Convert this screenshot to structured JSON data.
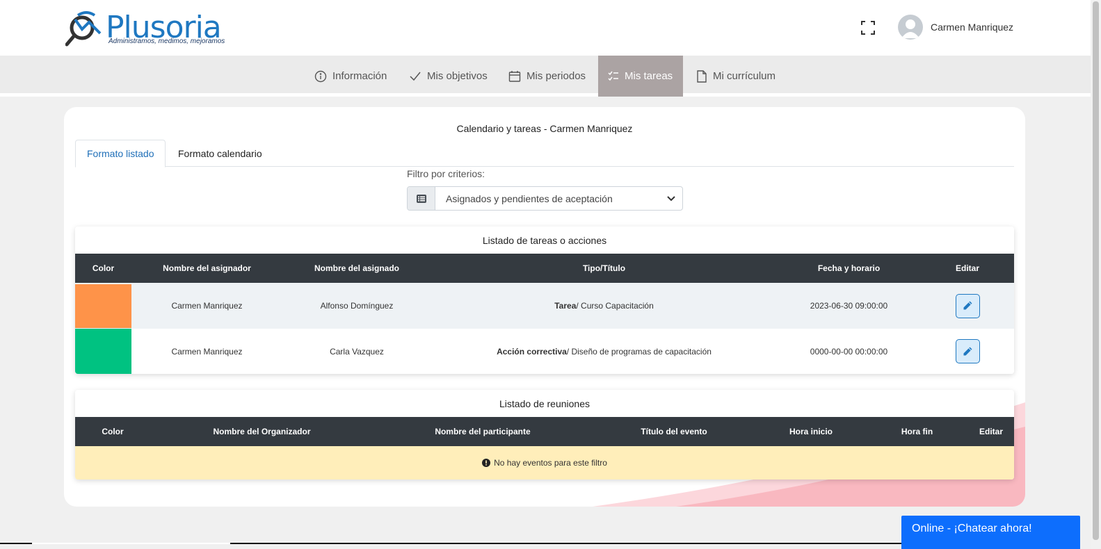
{
  "header": {
    "logo_text": "Plusoria",
    "logo_tagline": "Administramos, medimos, mejoramos",
    "user_name": "Carmen Manriquez"
  },
  "nav": [
    {
      "label": "Información",
      "icon": "info-icon"
    },
    {
      "label": "Mis objetivos",
      "icon": "check-icon"
    },
    {
      "label": "Mis periodos",
      "icon": "calendar-icon"
    },
    {
      "label": "Mis tareas",
      "icon": "tasks-icon",
      "active": true
    },
    {
      "label": "Mi currículum",
      "icon": "document-icon"
    }
  ],
  "page": {
    "title": "Calendario y tareas - Carmen Manriquez",
    "tabs": [
      "Formato listado",
      "Formato calendario"
    ],
    "filter_label": "Filtro por criterios:",
    "filter_value": "Asignados y pendientes de aceptación"
  },
  "tasks": {
    "title": "Listado de tareas o acciones",
    "columns": [
      "Color",
      "Nombre del asignador",
      "Nombre del asignado",
      "Tipo/Título",
      "Fecha y horario",
      "Editar"
    ],
    "rows": [
      {
        "color": "#fe9349",
        "assigner": "Carmen Manriquez",
        "assignee": "Alfonso Domínguez",
        "type": "Tarea",
        "title": "/ Curso Capacitación",
        "datetime": "2023-06-30 09:00:00"
      },
      {
        "color": "#00c281",
        "assigner": "Carmen Manriquez",
        "assignee": "Carla Vazquez",
        "type": "Acción correctiva",
        "title": "/ Diseño de programas de capacitación",
        "datetime": "0000-00-00 00:00:00"
      }
    ]
  },
  "meetings": {
    "title": "Listado de reuniones",
    "columns": [
      "Color",
      "Nombre del Organizador",
      "Nombre del participante",
      "Título del evento",
      "Hora inicio",
      "Hora fin",
      "Editar"
    ],
    "empty_message": "No hay eventos para este filtro"
  },
  "chat": {
    "label": "Online - ¡Chatear ahora!"
  },
  "colors": {
    "brand": "#1f78c1",
    "nav_active": "#aba3a3",
    "table_header": "#343a40",
    "empty_row": "#ffeeba",
    "chat": "#0d6efd"
  }
}
